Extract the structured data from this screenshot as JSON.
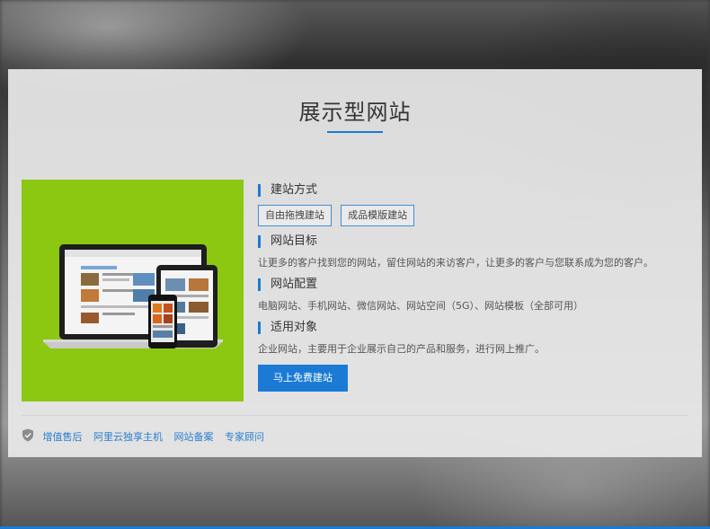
{
  "section": {
    "title": "展示型网站"
  },
  "info": {
    "build_method": {
      "heading": "建站方式",
      "tags": [
        "自由拖拽建站",
        "成品模版建站"
      ]
    },
    "goal": {
      "heading": "网站目标",
      "text": "让更多的客户找到您的网站，留住网站的来访客户，让更多的客户与您联系成为您的客户。"
    },
    "config": {
      "heading": "网站配置",
      "text": "电脑网站、手机网站、微信网站、网站空间（5G）、网站模板（全部可用）"
    },
    "audience": {
      "heading": "适用对象",
      "text": "企业网站，主要用于企业展示自己的产品和服务，进行网上推广。"
    }
  },
  "cta": {
    "label": "马上免费建站"
  },
  "footer": {
    "links": [
      "增值售后",
      "阿里云独享主机",
      "网站备案",
      "专家顾问"
    ]
  },
  "colors": {
    "accent": "#1b7bd4",
    "image_bg": "#8cc711"
  }
}
